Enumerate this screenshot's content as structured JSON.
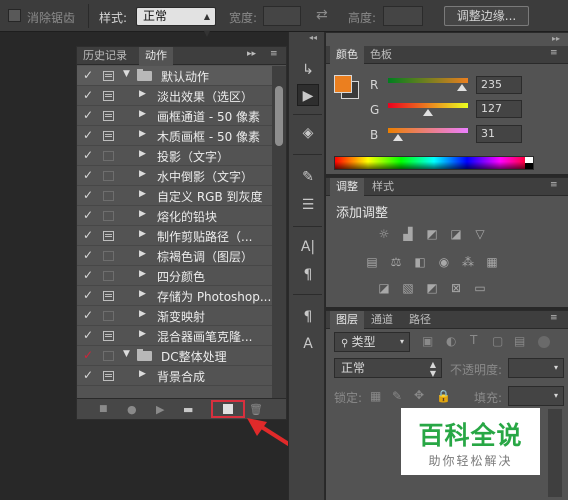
{
  "options_bar": {
    "antialias_label": "消除锯齿",
    "style_label": "样式:",
    "style_value": "正常",
    "width_label": "宽度:",
    "height_label": "高度:",
    "refine_edge_button": "调整边缘..."
  },
  "actions_panel": {
    "tabs": [
      "历史记录",
      "动作"
    ],
    "active_tab": "动作",
    "items": [
      {
        "label": "默认动作",
        "level": 0,
        "expanded": true,
        "dialog": true,
        "check_red": false
      },
      {
        "label": "淡出效果（选区）",
        "level": 1,
        "dialog": true,
        "check_red": false
      },
      {
        "label": "画框通道 - 50 像素",
        "level": 1,
        "dialog": true,
        "check_red": false
      },
      {
        "label": "木质画框 - 50 像素",
        "level": 1,
        "dialog": true,
        "check_red": false
      },
      {
        "label": "投影（文字）",
        "level": 1,
        "dialog": false,
        "check_red": false
      },
      {
        "label": "水中倒影（文字）",
        "level": 1,
        "dialog": false,
        "check_red": false
      },
      {
        "label": "自定义 RGB 到灰度",
        "level": 1,
        "dialog": false,
        "check_red": false
      },
      {
        "label": "熔化的铅块",
        "level": 1,
        "dialog": false,
        "check_red": false
      },
      {
        "label": "制作剪贴路径（...",
        "level": 1,
        "dialog": true,
        "check_red": false
      },
      {
        "label": "棕褐色调（图层）",
        "level": 1,
        "dialog": false,
        "check_red": false
      },
      {
        "label": "四分颜色",
        "level": 1,
        "dialog": false,
        "check_red": false
      },
      {
        "label": "存储为 Photoshop...",
        "level": 1,
        "dialog": true,
        "check_red": false
      },
      {
        "label": "渐变映射",
        "level": 1,
        "dialog": false,
        "check_red": false
      },
      {
        "label": "混合器画笔克隆...",
        "level": 1,
        "dialog": true,
        "check_red": false
      },
      {
        "label": "DC整体处理",
        "level": 0,
        "expanded": true,
        "dialog": false,
        "check_red": true
      },
      {
        "label": "背景合成",
        "level": 1,
        "dialog": true,
        "check_red": false
      }
    ],
    "bottom_buttons": [
      "stop-icon",
      "record-icon",
      "play-icon",
      "new-set-icon",
      "new-action-icon",
      "delete-icon"
    ]
  },
  "color_panel": {
    "tabs": [
      "颜色",
      "色板"
    ],
    "channels": [
      {
        "label": "R",
        "value": "235",
        "level": 235
      },
      {
        "label": "G",
        "value": "127",
        "level": 127
      },
      {
        "label": "B",
        "value": "31",
        "level": 31
      }
    ],
    "foreground": "#eb7f1f"
  },
  "adjustments_panel": {
    "tabs": [
      "调整",
      "样式"
    ],
    "title": "添加调整"
  },
  "layers_panel": {
    "tabs": [
      "图层",
      "通道",
      "路径"
    ],
    "filter_label": "类型",
    "blend_mode": "正常",
    "opacity_label": "不透明度:",
    "lock_label": "锁定:",
    "fill_label": "填充:"
  },
  "watermark": {
    "title": "百科全说",
    "subtitle": "助你轻松解决"
  }
}
